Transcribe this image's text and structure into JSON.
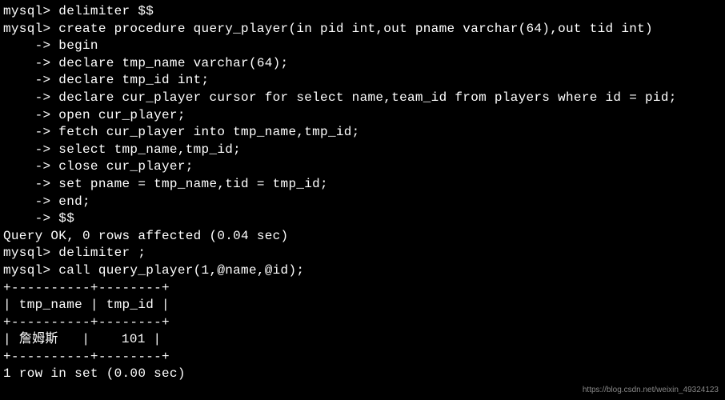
{
  "lines": [
    {
      "text": "mysql> delimiter $$"
    },
    {
      "text": "mysql> create procedure query_player(in pid int,out pname varchar(64),out tid int)"
    },
    {
      "text": "    -> begin"
    },
    {
      "text": "    -> declare tmp_name varchar(64);"
    },
    {
      "text": "    -> declare tmp_id int;"
    },
    {
      "text": "    -> declare cur_player cursor for select name,team_id from players where id = pid;"
    },
    {
      "text": "    -> open cur_player;"
    },
    {
      "text": "    -> fetch cur_player into tmp_name,tmp_id;"
    },
    {
      "text": "    -> select tmp_name,tmp_id;"
    },
    {
      "text": "    -> close cur_player;"
    },
    {
      "text": "    -> set pname = tmp_name,tid = tmp_id;"
    },
    {
      "text": "    -> end;"
    },
    {
      "text": "    -> $$"
    },
    {
      "text": "Query OK, 0 rows affected (0.04 sec)"
    },
    {
      "text": ""
    },
    {
      "text": "mysql> delimiter ;"
    },
    {
      "text": "mysql> call query_player(1,@name,@id);"
    },
    {
      "text": "+----------+--------+"
    },
    {
      "text": "| tmp_name | tmp_id |"
    },
    {
      "text": "+----------+--------+"
    },
    {
      "text": "| 詹姆斯   |    101 |"
    },
    {
      "text": "+----------+--------+"
    },
    {
      "text": "1 row in set (0.00 sec)"
    }
  ],
  "watermark": "https://blog.csdn.net/weixin_49324123"
}
